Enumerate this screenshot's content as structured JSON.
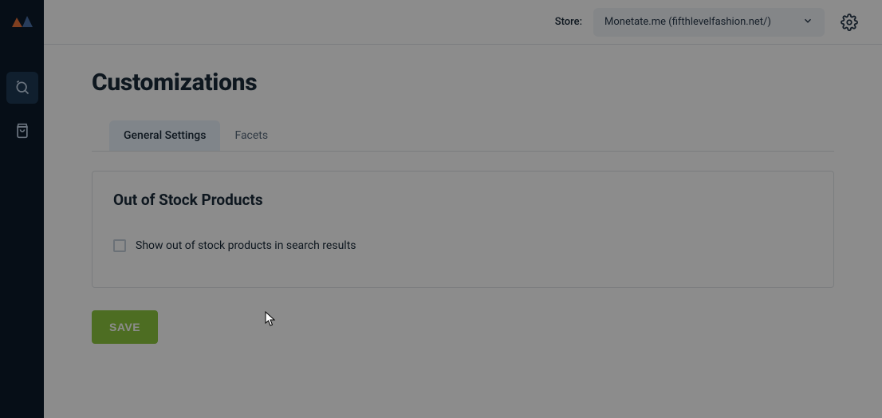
{
  "topbar": {
    "store_label": "Store:",
    "store_value": "Monetate.me (fifthlevelfashion.net/)"
  },
  "page": {
    "title": "Customizations"
  },
  "tabs": [
    {
      "label": "General Settings"
    },
    {
      "label": "Facets"
    }
  ],
  "panel": {
    "title": "Out of Stock Products",
    "checkbox_label": "Show out of stock products in search results"
  },
  "actions": {
    "save_label": "SAVE"
  }
}
